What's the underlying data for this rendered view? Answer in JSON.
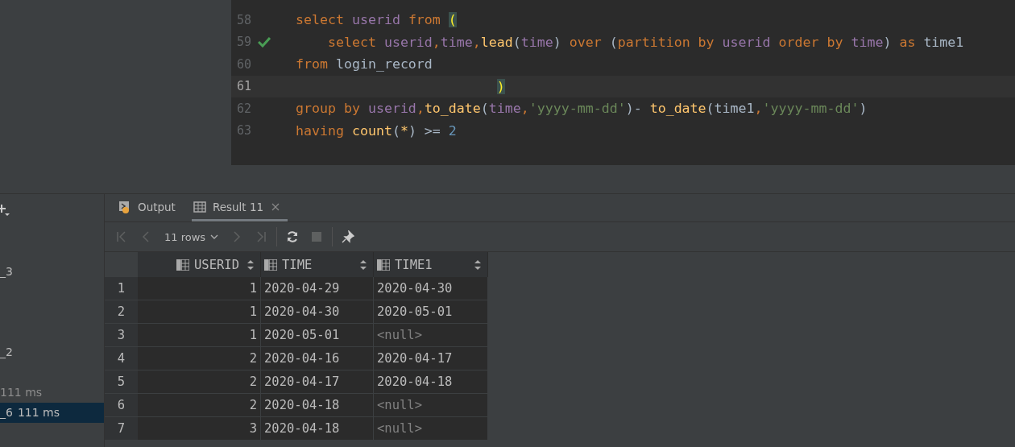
{
  "editor": {
    "lines": [
      {
        "number": "58",
        "current": false,
        "ok": false,
        "tokens": [
          {
            "t": "select ",
            "kind": "kw"
          },
          {
            "t": "userid ",
            "kind": "id"
          },
          {
            "t": "from ",
            "kind": "kw"
          },
          {
            "t": "(",
            "kind": "match"
          }
        ]
      },
      {
        "number": "59",
        "current": false,
        "ok": true,
        "tokens": [
          {
            "t": "    select ",
            "kind": "kw"
          },
          {
            "t": "userid",
            "kind": "id"
          },
          {
            "t": ",",
            "kind": "kw"
          },
          {
            "t": "time",
            "kind": "id"
          },
          {
            "t": ",",
            "kind": "kw"
          },
          {
            "t": "lead",
            "kind": "fn"
          },
          {
            "t": "(",
            "kind": "plain"
          },
          {
            "t": "time",
            "kind": "id"
          },
          {
            "t": ") ",
            "kind": "plain"
          },
          {
            "t": "over ",
            "kind": "kw"
          },
          {
            "t": "(",
            "kind": "plain"
          },
          {
            "t": "partition by ",
            "kind": "kw"
          },
          {
            "t": "userid ",
            "kind": "id"
          },
          {
            "t": "order by ",
            "kind": "kw"
          },
          {
            "t": "time",
            "kind": "id"
          },
          {
            "t": ") ",
            "kind": "plain"
          },
          {
            "t": "as ",
            "kind": "kw"
          },
          {
            "t": "time1",
            "kind": "plain"
          }
        ]
      },
      {
        "number": "60",
        "current": false,
        "ok": false,
        "tokens": [
          {
            "t": "from ",
            "kind": "kw"
          },
          {
            "t": "login_record",
            "kind": "plain"
          }
        ]
      },
      {
        "number": "61",
        "current": true,
        "ok": false,
        "tokens": [
          {
            "t": "                         )",
            "kind": "match"
          }
        ]
      },
      {
        "number": "62",
        "current": false,
        "ok": false,
        "tokens": [
          {
            "t": "group by ",
            "kind": "kw"
          },
          {
            "t": "userid",
            "kind": "id"
          },
          {
            "t": ",",
            "kind": "kw"
          },
          {
            "t": "to_date",
            "kind": "fn"
          },
          {
            "t": "(",
            "kind": "plain"
          },
          {
            "t": "time",
            "kind": "id"
          },
          {
            "t": ",",
            "kind": "kw"
          },
          {
            "t": "'yyyy-mm-dd'",
            "kind": "str"
          },
          {
            "t": ")- ",
            "kind": "plain"
          },
          {
            "t": "to_date",
            "kind": "fn"
          },
          {
            "t": "(time1",
            "kind": "plain"
          },
          {
            "t": ",",
            "kind": "kw"
          },
          {
            "t": "'yyyy-mm-dd'",
            "kind": "str"
          },
          {
            "t": ")",
            "kind": "plain"
          }
        ]
      },
      {
        "number": "63",
        "current": false,
        "ok": false,
        "tokens": [
          {
            "t": "having ",
            "kind": "kw"
          },
          {
            "t": "count",
            "kind": "fn"
          },
          {
            "t": "(",
            "kind": "plain"
          },
          {
            "t": "*",
            "kind": "fn"
          },
          {
            "t": ") >= ",
            "kind": "plain"
          },
          {
            "t": "2",
            "kind": "num"
          }
        ]
      }
    ]
  },
  "sidebar": {
    "items": [
      {
        "label": "_3",
        "selected": false
      },
      {
        "label": "_2",
        "selected": false
      },
      {
        "time": "111 ms",
        "selected": false
      },
      {
        "label": "_6",
        "time": "111 ms",
        "selected": true
      }
    ]
  },
  "tabs": [
    {
      "label": "Output",
      "kind": "output",
      "selected": false
    },
    {
      "label": "Result 11",
      "kind": "result",
      "selected": true
    }
  ],
  "toolbar": {
    "rows": "11 rows"
  },
  "table": {
    "columns": [
      "USERID",
      "TIME",
      "TIME1"
    ],
    "rows": [
      {
        "n": "1",
        "cells": [
          "1",
          "2020-04-29",
          "2020-04-30"
        ]
      },
      {
        "n": "2",
        "cells": [
          "1",
          "2020-04-30",
          "2020-05-01"
        ]
      },
      {
        "n": "3",
        "cells": [
          "1",
          "2020-05-01",
          "<null>"
        ]
      },
      {
        "n": "4",
        "cells": [
          "2",
          "2020-04-16",
          "2020-04-17"
        ]
      },
      {
        "n": "5",
        "cells": [
          "2",
          "2020-04-17",
          "2020-04-18"
        ]
      },
      {
        "n": "6",
        "cells": [
          "2",
          "2020-04-18",
          "<null>"
        ]
      },
      {
        "n": "7",
        "cells": [
          "3",
          "2020-04-18",
          "<null>"
        ]
      }
    ]
  }
}
